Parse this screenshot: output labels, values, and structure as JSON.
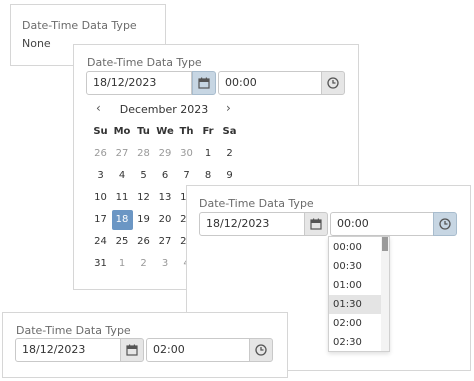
{
  "panel1": {
    "label": "Date-Time Data Type",
    "value": "None"
  },
  "panel2": {
    "label": "Date-Time Data Type",
    "date": "18/12/2023",
    "time": "00:00",
    "calendar": {
      "month_year": "December 2023",
      "prev_icon": "chevron-left-icon",
      "next_icon": "chevron-right-icon",
      "weekdays": [
        "Su",
        "Mo",
        "Tu",
        "We",
        "Th",
        "Fr",
        "Sa"
      ],
      "weeks": [
        [
          "26",
          "27",
          "28",
          "29",
          "30",
          "1",
          "2"
        ],
        [
          "3",
          "4",
          "5",
          "6",
          "7",
          "8",
          "9"
        ],
        [
          "10",
          "11",
          "12",
          "13",
          "14",
          "15",
          "16"
        ],
        [
          "17",
          "18",
          "19",
          "20",
          "21",
          "22",
          "23"
        ],
        [
          "24",
          "25",
          "26",
          "27",
          "28",
          "29",
          "30"
        ],
        [
          "31",
          "1",
          "2",
          "3",
          "4",
          "5",
          "6"
        ]
      ],
      "selected_day": "18"
    }
  },
  "panel3": {
    "label": "Date-Time Data Type",
    "date": "18/12/2023",
    "time": "00:00",
    "time_options": [
      "00:00",
      "00:30",
      "01:00",
      "01:30",
      "02:00",
      "02:30"
    ],
    "hovered_option": "01:30"
  },
  "panel4": {
    "label": "Date-Time Data Type",
    "date": "18/12/2023",
    "time": "02:00"
  },
  "colors": {
    "accent": "#6b96c4",
    "active_button": "#c7d6e3",
    "hover_row": "#e4e4e4"
  }
}
